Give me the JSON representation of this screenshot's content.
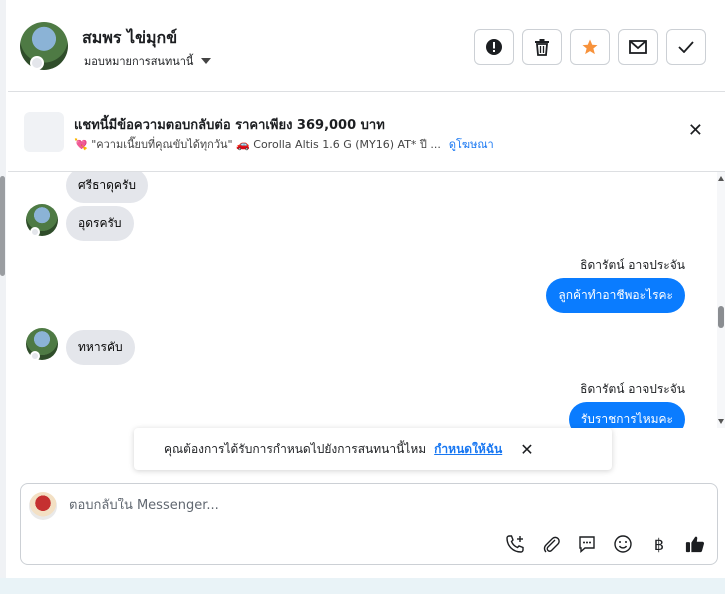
{
  "header": {
    "name": "สมพร ไข่มุกข์",
    "assign_label": "มอบหมายการสนทนานี้"
  },
  "banner": {
    "title": "แชทนี้มีข้อความตอบกลับต่อ ราคาเพียง 369,000 บาท",
    "subtitle": "💘 \"ความเนี๊ยบที่คุณขับได้ทุกวัน\" 🚗 Corolla Altis 1.6 G (MY16) AT* ปี ...",
    "link": "ดูโฆษณา"
  },
  "messages": [
    {
      "side": "in",
      "text": "ศรีธาดุครับ"
    },
    {
      "side": "in",
      "text": "อุดรครับ"
    },
    {
      "side": "out",
      "sender": "ธิดารัตน์ อาจประจัน",
      "text": "ลูกค้าทำอาชีพอะไรคะ"
    },
    {
      "side": "in",
      "text": "ทหารคับ"
    },
    {
      "side": "out",
      "sender": "ธิดารัตน์ อาจประจัน",
      "text": "รับราชการไหมคะ"
    }
  ],
  "toast": {
    "message": "คุณต้องการได้รับการกำหนดไปยังการสนทนานี้ไหม",
    "link": "กำหนดให้ฉัน"
  },
  "composer": {
    "placeholder": "ตอบกลับใน Messenger..."
  },
  "colors": {
    "accent": "#0a7cff",
    "star": "#f7923b",
    "link": "#1877f2"
  }
}
